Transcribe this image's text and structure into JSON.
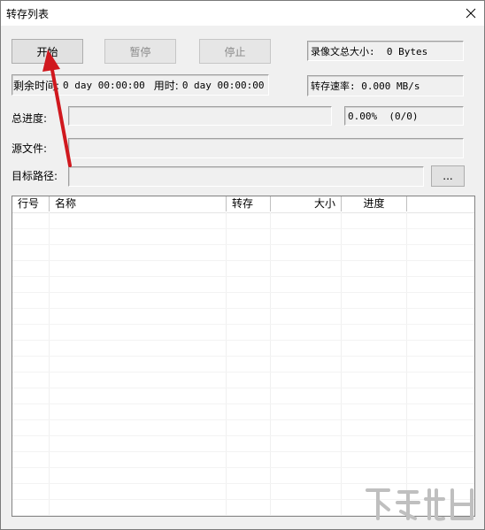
{
  "window": {
    "title": "转存列表"
  },
  "buttons": {
    "start": "开始",
    "pause": "暂停",
    "stop": "停止",
    "browse": "..."
  },
  "info": {
    "video_total_size": "录像文总大小:  0 Bytes",
    "remaining_label": "剩余时间:",
    "remaining_value": "0 day 00:00:00",
    "elapsed_label": "用时:",
    "elapsed_value": "0 day 00:00:00",
    "speed": "转存速率: 0.000 MB/s"
  },
  "progress": {
    "label": "总进度:",
    "percent_text": "0.00%  (0/0)",
    "value": 0
  },
  "fields": {
    "source_label": "源文件:",
    "source_value": "",
    "target_label": "目标路径:",
    "target_value": ""
  },
  "table": {
    "columns": [
      "行号",
      "名称",
      "转存",
      "大小",
      "进度"
    ],
    "rows": []
  },
  "colors": {
    "annotation_arrow": "#d0181e",
    "watermark": "#bfbfbf"
  },
  "icons": {
    "close": "close-icon",
    "arrow": "red-arrow-annotation",
    "watermark": "xiazaiba-watermark-logo"
  }
}
